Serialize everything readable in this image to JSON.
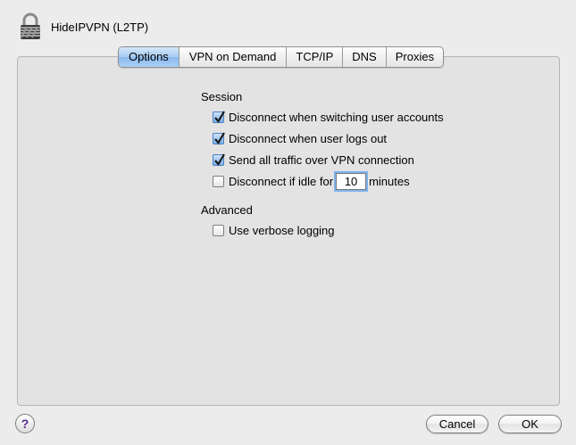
{
  "window": {
    "title": "HideIPVPN (L2TP)",
    "icon": "lock-icon"
  },
  "tabs": [
    {
      "label": "Options",
      "active": true
    },
    {
      "label": "VPN on Demand",
      "active": false
    },
    {
      "label": "TCP/IP",
      "active": false
    },
    {
      "label": "DNS",
      "active": false
    },
    {
      "label": "Proxies",
      "active": false
    }
  ],
  "session": {
    "heading": "Session",
    "options": [
      {
        "label": "Disconnect when switching user accounts",
        "checked": true
      },
      {
        "label": "Disconnect when user logs out",
        "checked": true
      },
      {
        "label": "Send all traffic over VPN connection",
        "checked": true
      }
    ],
    "idle": {
      "label_before": "Disconnect if idle for",
      "value": "10",
      "label_after": "minutes",
      "checked": false
    }
  },
  "advanced": {
    "heading": "Advanced",
    "options": [
      {
        "label": "Use verbose logging",
        "checked": false
      }
    ]
  },
  "footer": {
    "help_label": "?",
    "cancel_label": "Cancel",
    "ok_label": "OK"
  },
  "colors": {
    "window_bg": "#ececec",
    "panel_bg": "#e3e3e3",
    "active_tab": "#a6cbf2",
    "checkbox_checked": "#79b1ef"
  }
}
